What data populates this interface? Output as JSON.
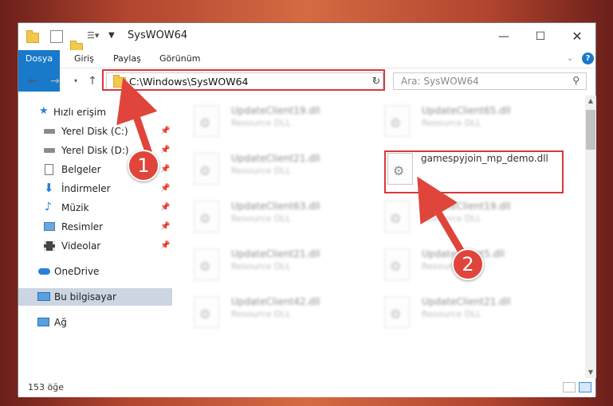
{
  "window": {
    "title": "SysWOW64"
  },
  "ribbon": {
    "tabs": [
      "Dosya",
      "Giriş",
      "Paylaş",
      "Görünüm"
    ]
  },
  "address": {
    "path": "C:\\Windows\\SysWOW64"
  },
  "search": {
    "placeholder": "Ara: SysWOW64"
  },
  "nav": {
    "quick_access": "Hızlı erişim",
    "items": [
      {
        "label": "Yerel Disk (C:)",
        "icon": "drive-icon",
        "pinned": true
      },
      {
        "label": "Yerel Disk (D:)",
        "icon": "drive-icon",
        "pinned": true
      },
      {
        "label": "Belgeler",
        "icon": "documents-icon",
        "pinned": true
      },
      {
        "label": "İndirmeler",
        "icon": "download-icon",
        "pinned": true
      },
      {
        "label": "Müzik",
        "icon": "music-icon",
        "pinned": true
      },
      {
        "label": "Resimler",
        "icon": "pictures-icon",
        "pinned": true
      },
      {
        "label": "Videolar",
        "icon": "videos-icon",
        "pinned": true
      }
    ],
    "onedrive": "OneDrive",
    "this_pc": "Bu bilgisayar",
    "network": "Ağ"
  },
  "files": [
    {
      "name": "UpdateClient19.dll",
      "type": "Resource DLL"
    },
    {
      "name": "UpdateClient65.dll",
      "type": "Resource DLL"
    },
    {
      "name": "UpdateClient21.dll",
      "type": "Resource DLL"
    },
    {
      "name": "gamespyjoin_mp_demo.dll",
      "type": ""
    },
    {
      "name": "UpdateClient63.dll",
      "type": "Resource DLL"
    },
    {
      "name": "UpdateClient19.dll",
      "type": "Resource DLL"
    },
    {
      "name": "UpdateClient21.dll",
      "type": "Resource DLL"
    },
    {
      "name": "UpdateClient5.dll",
      "type": "Resource DLL"
    },
    {
      "name": "UpdateClient42.dll",
      "type": "Resource DLL"
    },
    {
      "name": "UpdateClient21.dll",
      "type": "Resource DLL"
    }
  ],
  "status": {
    "count": "153 öğe"
  },
  "annotations": {
    "step1": "1",
    "step2": "2"
  },
  "colors": {
    "accent": "#1979ca",
    "highlight": "#d9383a"
  }
}
